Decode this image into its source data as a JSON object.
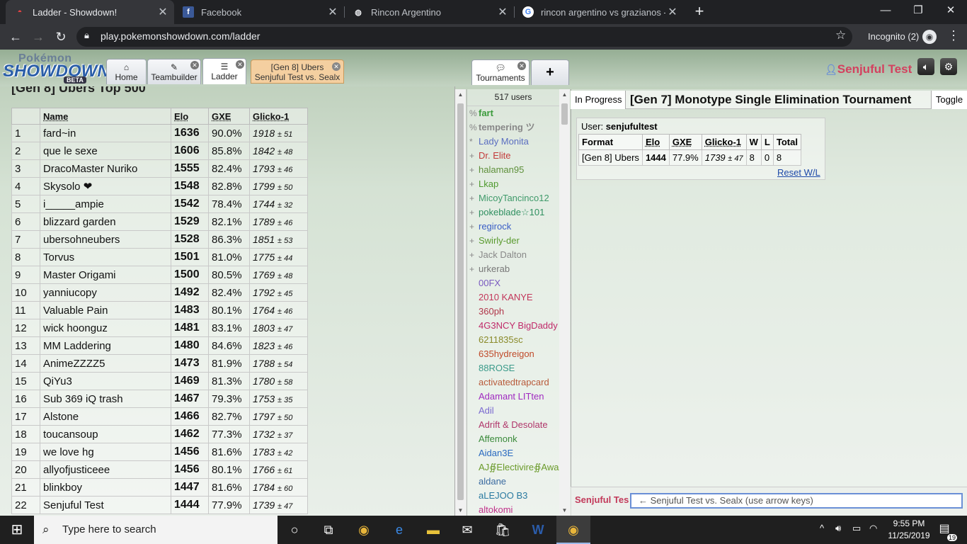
{
  "browser": {
    "tabs": [
      {
        "title": "Ladder - Showdown!",
        "active": true,
        "favicon": "pokeball-icon"
      },
      {
        "title": "Facebook",
        "active": false,
        "favicon": "facebook-icon"
      },
      {
        "title": "Rincon Argentino",
        "active": false,
        "favicon": "globe-icon"
      },
      {
        "title": "rincon argentino vs grazianos - G",
        "active": false,
        "favicon": "google-icon"
      }
    ],
    "url": "play.pokemonshowdown.com/ladder",
    "profile": "Incognito (2)"
  },
  "app": {
    "logo_top": "Pokémon",
    "logo_main": "SHOWDOWN",
    "logo_badge": "BETA",
    "tabs": {
      "home": "Home",
      "teambuilder": "Teambuilder",
      "ladder": "Ladder"
    },
    "battle_tab": {
      "line1": "[Gen 8] Ubers",
      "line2": "Senjuful Test vs. Sealx"
    },
    "username": "Senjuful Test",
    "tournaments_tab": "Tournaments"
  },
  "ladder": {
    "title": "[Gen 8] Ubers Top 500",
    "headers": [
      "",
      "Name",
      "Elo",
      "GXE",
      "Glicko-1"
    ],
    "rows": [
      {
        "rank": "1",
        "name": "fard~in",
        "elo": "1636",
        "gxe": "90.0%",
        "glicko": "1918",
        "dev": "± 51"
      },
      {
        "rank": "2",
        "name": "que le sexe",
        "elo": "1606",
        "gxe": "85.8%",
        "glicko": "1842",
        "dev": "± 48"
      },
      {
        "rank": "3",
        "name": "DracoMaster Nuriko",
        "elo": "1555",
        "gxe": "82.4%",
        "glicko": "1793",
        "dev": "± 46"
      },
      {
        "rank": "4",
        "name": "Skysolo ❤",
        "elo": "1548",
        "gxe": "82.8%",
        "glicko": "1799",
        "dev": "± 50"
      },
      {
        "rank": "5",
        "name": "i_____ampie",
        "elo": "1542",
        "gxe": "78.4%",
        "glicko": "1744",
        "dev": "± 32"
      },
      {
        "rank": "6",
        "name": "blizzard garden",
        "elo": "1529",
        "gxe": "82.1%",
        "glicko": "1789",
        "dev": "± 46"
      },
      {
        "rank": "7",
        "name": "ubersohneubers",
        "elo": "1528",
        "gxe": "86.3%",
        "glicko": "1851",
        "dev": "± 53"
      },
      {
        "rank": "8",
        "name": "Torvus",
        "elo": "1501",
        "gxe": "81.0%",
        "glicko": "1775",
        "dev": "± 44"
      },
      {
        "rank": "9",
        "name": "Master Origami",
        "elo": "1500",
        "gxe": "80.5%",
        "glicko": "1769",
        "dev": "± 48"
      },
      {
        "rank": "10",
        "name": "yanniucopy",
        "elo": "1492",
        "gxe": "82.4%",
        "glicko": "1792",
        "dev": "± 45"
      },
      {
        "rank": "11",
        "name": "Valuable Pain",
        "elo": "1483",
        "gxe": "80.1%",
        "glicko": "1764",
        "dev": "± 46"
      },
      {
        "rank": "12",
        "name": "wick hoonguz",
        "elo": "1481",
        "gxe": "83.1%",
        "glicko": "1803",
        "dev": "± 47"
      },
      {
        "rank": "13",
        "name": "MM Laddering",
        "elo": "1480",
        "gxe": "84.6%",
        "glicko": "1823",
        "dev": "± 46"
      },
      {
        "rank": "14",
        "name": "AnimeZZZZ5",
        "elo": "1473",
        "gxe": "81.9%",
        "glicko": "1788",
        "dev": "± 54"
      },
      {
        "rank": "15",
        "name": "QiYu3",
        "elo": "1469",
        "gxe": "81.3%",
        "glicko": "1780",
        "dev": "± 58"
      },
      {
        "rank": "16",
        "name": "Sub 369 iQ trash",
        "elo": "1467",
        "gxe": "79.3%",
        "glicko": "1753",
        "dev": "± 35"
      },
      {
        "rank": "17",
        "name": "Alstone",
        "elo": "1466",
        "gxe": "82.7%",
        "glicko": "1797",
        "dev": "± 50"
      },
      {
        "rank": "18",
        "name": "toucansoup",
        "elo": "1462",
        "gxe": "77.3%",
        "glicko": "1732",
        "dev": "± 37"
      },
      {
        "rank": "19",
        "name": "we love hg",
        "elo": "1456",
        "gxe": "81.6%",
        "glicko": "1783",
        "dev": "± 42"
      },
      {
        "rank": "20",
        "name": "allyofjusticeee",
        "elo": "1456",
        "gxe": "80.1%",
        "glicko": "1766",
        "dev": "± 61"
      },
      {
        "rank": "21",
        "name": "blinkboy",
        "elo": "1447",
        "gxe": "81.6%",
        "glicko": "1784",
        "dev": "± 60"
      },
      {
        "rank": "22",
        "name": "Senjuful Test",
        "elo": "1444",
        "gxe": "77.9%",
        "glicko": "1739",
        "dev": "± 47"
      }
    ]
  },
  "userlist": {
    "count": "517 users",
    "users": [
      {
        "rank": "%",
        "name": "fart",
        "color": "#3b9b3b",
        "bold": true
      },
      {
        "rank": "%",
        "name": "tempering ツ",
        "color": "#888888",
        "bold": true
      },
      {
        "rank": "*",
        "name": "Lady Monita",
        "color": "#5a6ec0",
        "bold": false
      },
      {
        "rank": "+",
        "name": "Dr. Elite",
        "color": "#c33a3a",
        "bold": false
      },
      {
        "rank": "+",
        "name": "halaman95",
        "color": "#5e8f3a",
        "bold": false
      },
      {
        "rank": "+",
        "name": "Lkap",
        "color": "#4f9a2f",
        "bold": false
      },
      {
        "rank": "+",
        "name": "MicoyTancinco12",
        "color": "#3f9a6a",
        "bold": false
      },
      {
        "rank": "+",
        "name": "pokeblade☆101",
        "color": "#2f8f5f",
        "bold": false
      },
      {
        "rank": "+",
        "name": "regirock",
        "color": "#3a5ec6",
        "bold": false
      },
      {
        "rank": "+",
        "name": "Swirly-der",
        "color": "#5a9a2f",
        "bold": false
      },
      {
        "rank": "+",
        "name": "Jack Dalton",
        "color": "#888888",
        "bold": false
      },
      {
        "rank": "+",
        "name": "urkerab",
        "color": "#777777",
        "bold": false
      },
      {
        "rank": "",
        "name": "00FX",
        "color": "#7a5ac0",
        "bold": false
      },
      {
        "rank": "",
        "name": "2010 KANYE",
        "color": "#c3365a",
        "bold": false
      },
      {
        "rank": "",
        "name": "360ph",
        "color": "#b0364a",
        "bold": false
      },
      {
        "rank": "",
        "name": "4G3NCY BigDaddy",
        "color": "#c02a6a",
        "bold": false
      },
      {
        "rank": "",
        "name": "6211835sc",
        "color": "#8a8a2a",
        "bold": false
      },
      {
        "rank": "",
        "name": "635hydreigon",
        "color": "#c04a2a",
        "bold": false
      },
      {
        "rank": "",
        "name": "88ROSE",
        "color": "#3a9a8a",
        "bold": false
      },
      {
        "rank": "",
        "name": "activatedtrapcard",
        "color": "#b85a3a",
        "bold": false
      },
      {
        "rank": "",
        "name": "Adamant LITten",
        "color": "#a02ac0",
        "bold": false
      },
      {
        "rank": "",
        "name": "Adil",
        "color": "#7a6ad0",
        "bold": false
      },
      {
        "rank": "",
        "name": "Adrift & Desolate",
        "color": "#b0366a",
        "bold": false
      },
      {
        "rank": "",
        "name": "Affemonk",
        "color": "#3a8a3a",
        "bold": false
      },
      {
        "rank": "",
        "name": "Aidan3E",
        "color": "#2a6ac0",
        "bold": false
      },
      {
        "rank": "",
        "name": "AJ∯Electivire∯Awa",
        "color": "#6a9a2a",
        "bold": false
      },
      {
        "rank": "",
        "name": "aldane",
        "color": "#3a6aa0",
        "bold": false
      },
      {
        "rank": "",
        "name": "aLEJOO B3",
        "color": "#2a7aa0",
        "bold": false
      },
      {
        "rank": "",
        "name": "altokomi",
        "color": "#c0308a",
        "bold": false
      }
    ]
  },
  "tournament": {
    "status": "In Progress",
    "name": "[Gen 7] Monotype Single Elimination Tournament",
    "toggle": "Toggle",
    "user_label": "User:",
    "user_name": "senjufultest",
    "headers": [
      "Format",
      "Elo",
      "GXE",
      "Glicko-1",
      "W",
      "L",
      "Total"
    ],
    "row": {
      "format": "[Gen 8] Ubers",
      "elo": "1444",
      "gxe": "77.9%",
      "glicko": "1739",
      "dev": "± 47",
      "w": "8",
      "l": "0",
      "total": "8"
    },
    "reset": "Reset W/L"
  },
  "chat": {
    "name": "Senjuful Tes",
    "placeholder": "← Senjuful Test vs. Sealx (use arrow keys)"
  },
  "taskbar": {
    "search_placeholder": "Type here to search",
    "time": "9:55 PM",
    "date": "11/25/2019",
    "notifications": "19"
  }
}
